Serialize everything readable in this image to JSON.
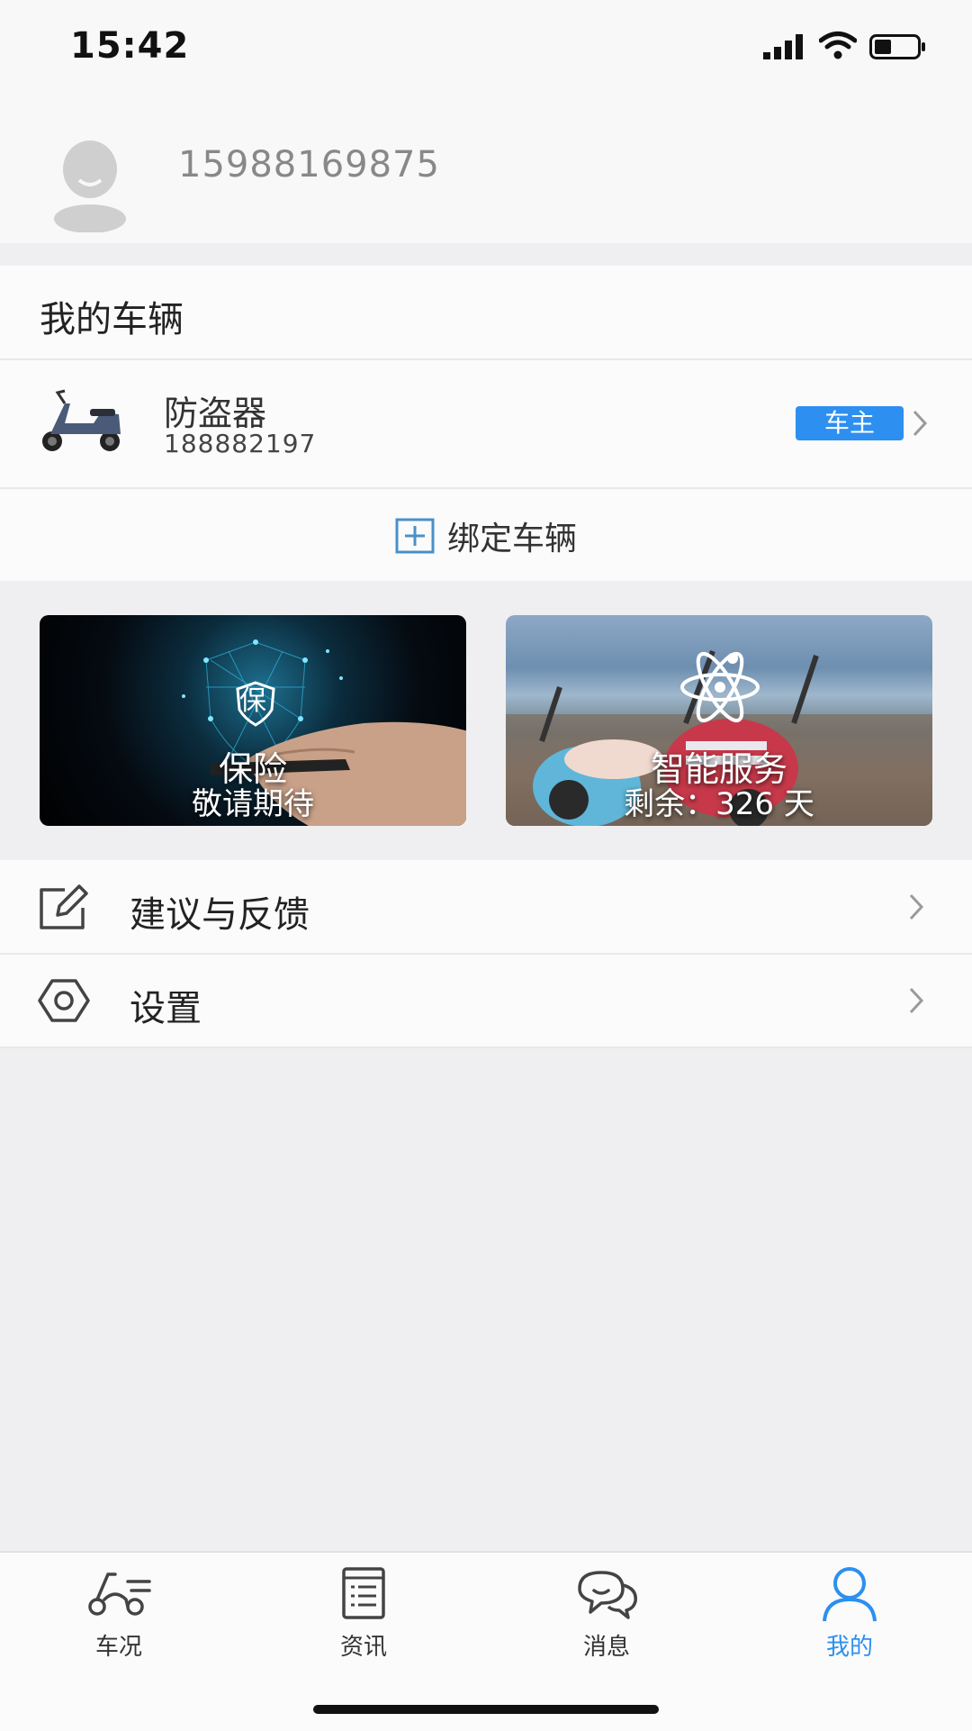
{
  "status_bar": {
    "time": "15:42"
  },
  "profile": {
    "phone": "15988169875"
  },
  "vehicles": {
    "section_title": "我的车辆",
    "items": [
      {
        "name": "防盗器",
        "id": "188882197",
        "badge": "车主"
      }
    ],
    "bind_label": "绑定车辆"
  },
  "cards": [
    {
      "title": "保险",
      "subtitle": "敬请期待",
      "emblem": "保"
    },
    {
      "title": "智能服务",
      "subtitle": "剩余：326 天"
    }
  ],
  "menu": [
    {
      "label": "建议与反馈",
      "icon": "edit-icon"
    },
    {
      "label": "设置",
      "icon": "gear-icon"
    }
  ],
  "tabs": [
    {
      "label": "车况",
      "icon": "scooter-icon"
    },
    {
      "label": "资讯",
      "icon": "news-icon"
    },
    {
      "label": "消息",
      "icon": "chat-icon"
    },
    {
      "label": "我的",
      "icon": "user-icon",
      "active": true
    }
  ],
  "colors": {
    "accent": "#2d8ff0",
    "background": "#efeff1"
  }
}
